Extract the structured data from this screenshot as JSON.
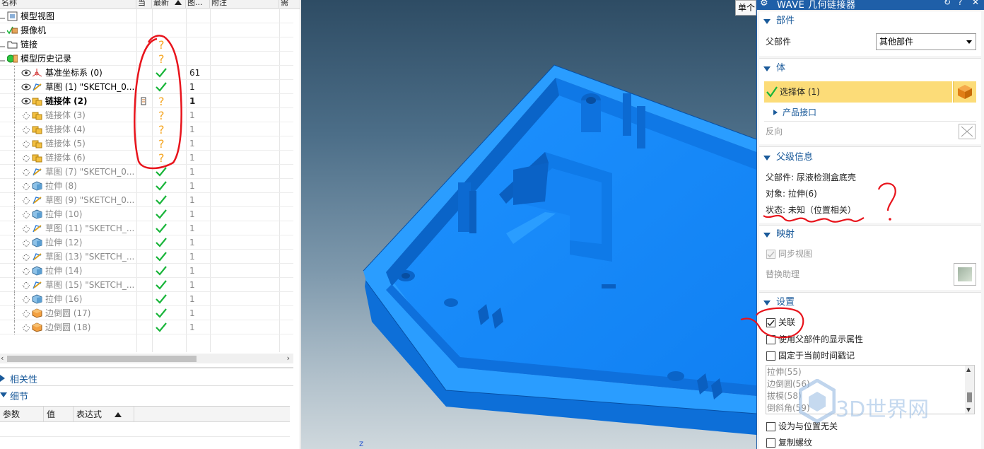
{
  "navigator": {
    "columns": [
      "名称",
      "当",
      "最新",
      "图...",
      "附注",
      "需"
    ],
    "rows": [
      {
        "label": "模型视图",
        "icon": "model-view-icon",
        "status": "",
        "count": "",
        "style": "top",
        "x": 10
      },
      {
        "label": "摄像机",
        "icon": "camera-icon",
        "status": "",
        "count": "",
        "style": "top",
        "x": 10
      },
      {
        "label": "链接",
        "icon": "folder-icon",
        "status": "question",
        "count": "",
        "style": "top",
        "x": 10
      },
      {
        "label": "模型历史记录",
        "icon": "history-icon",
        "status": "question",
        "count": "",
        "style": "top",
        "x": 10
      },
      {
        "label": "基准坐标系 (0)",
        "icon": "csys-icon",
        "status": "check",
        "count": "61",
        "style": "normal",
        "x": 30
      },
      {
        "label": "草图 (1) \"SKETCH_0...",
        "icon": "sketch-icon",
        "status": "check",
        "count": "1",
        "style": "normal",
        "x": 30
      },
      {
        "label": "链接体 (2)",
        "icon": "linked-body-icon",
        "status": "question",
        "count": "1",
        "style": "bold",
        "x": 30
      },
      {
        "label": "链接体 (3)",
        "icon": "linked-body-icon",
        "status": "question",
        "count": "1",
        "style": "dim",
        "x": 30
      },
      {
        "label": "链接体 (4)",
        "icon": "linked-body-icon",
        "status": "question",
        "count": "1",
        "style": "dim",
        "x": 30
      },
      {
        "label": "链接体 (5)",
        "icon": "linked-body-icon",
        "status": "question",
        "count": "1",
        "style": "dim",
        "x": 30
      },
      {
        "label": "链接体 (6)",
        "icon": "linked-body-icon",
        "status": "question",
        "count": "1",
        "style": "dim",
        "x": 30
      },
      {
        "label": "草图 (7) \"SKETCH_0...",
        "icon": "sketch-icon",
        "status": "check",
        "count": "1",
        "style": "dim",
        "x": 30
      },
      {
        "label": "拉伸 (8)",
        "icon": "extrude-icon",
        "status": "check",
        "count": "1",
        "style": "dim",
        "x": 30
      },
      {
        "label": "草图 (9) \"SKETCH_0...",
        "icon": "sketch-icon",
        "status": "check",
        "count": "1",
        "style": "dim",
        "x": 30
      },
      {
        "label": "拉伸 (10)",
        "icon": "extrude-icon",
        "status": "check",
        "count": "1",
        "style": "dim",
        "x": 30
      },
      {
        "label": "草图 (11) \"SKETCH_...",
        "icon": "sketch-icon",
        "status": "check",
        "count": "1",
        "style": "dim",
        "x": 30
      },
      {
        "label": "拉伸 (12)",
        "icon": "extrude-icon",
        "status": "check",
        "count": "1",
        "style": "dim",
        "x": 30
      },
      {
        "label": "草图 (13) \"SKETCH_...",
        "icon": "sketch-icon",
        "status": "check",
        "count": "1",
        "style": "dim",
        "x": 30
      },
      {
        "label": "拉伸 (14)",
        "icon": "extrude-icon",
        "status": "check",
        "count": "1",
        "style": "dim",
        "x": 30
      },
      {
        "label": "草图 (15) \"SKETCH_...",
        "icon": "sketch-icon",
        "status": "check",
        "count": "1",
        "style": "dim",
        "x": 30
      },
      {
        "label": "拉伸 (16)",
        "icon": "extrude-icon",
        "status": "check",
        "count": "1",
        "style": "dim",
        "x": 30
      },
      {
        "label": "边倒圆 (17)",
        "icon": "edge-blend-icon",
        "status": "check",
        "count": "1",
        "style": "dim",
        "x": 30
      },
      {
        "label": "边倒圆 (18)",
        "icon": "edge-blend-icon",
        "status": "check",
        "count": "1",
        "style": "dim",
        "x": 30
      }
    ],
    "sections": {
      "dependencies": "相关性",
      "details": "细节"
    },
    "detail_columns": [
      "参数",
      "值",
      "表达式"
    ]
  },
  "viewport": {
    "selection_filter": "单个",
    "axis_label": "Z"
  },
  "dialog": {
    "title": "WAVE 几何链接器",
    "group_part": {
      "heading": "部件",
      "parent_label": "父部件",
      "parent_value": "其他部件"
    },
    "group_body": {
      "heading": "体",
      "select_label": "选择体 (1)",
      "product_interface": "产品接口",
      "reverse_label": "反向"
    },
    "group_parent_info": {
      "heading": "父级信息",
      "parent_part": "父部件:  尿液检测盒底壳",
      "object": "对象:  拉伸(6)",
      "status": "状态:  未知（位置相关）"
    },
    "group_mapping": {
      "heading": "映射",
      "sync_view": "同步视图",
      "replace_helper": "替换助理"
    },
    "group_settings": {
      "heading": "设置",
      "associative": "关联",
      "use_parent_display": "使用父部件的显示属性",
      "fix_timestamp": "固定于当前时间戳记",
      "list_items": [
        "拉伸(55)",
        "边倒圆(56)",
        "拔模(58)",
        "倒斜角(59)"
      ],
      "position_independent": "设为与位置无关",
      "copy_threads": "复制螺纹"
    }
  },
  "watermark": "3D世界网",
  "colors": {
    "model_blue": "#1a8cff",
    "title_blue": "#1f5fa8",
    "highlight_yellow": "#fcdc78",
    "check_green": "#19b53a",
    "question_orange": "#f5a623",
    "annotation_red": "#e8141c"
  }
}
